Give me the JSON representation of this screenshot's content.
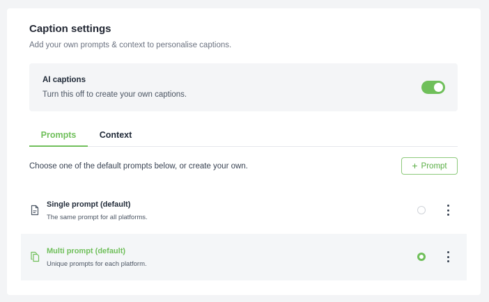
{
  "header": {
    "title": "Caption settings",
    "subtitle": "Add your own prompts & context to personalise captions."
  },
  "ai_captions": {
    "title": "AI captions",
    "description": "Turn this off to create your own captions.",
    "enabled": true
  },
  "tabs": [
    {
      "label": "Prompts",
      "active": true
    },
    {
      "label": "Context",
      "active": false
    }
  ],
  "prompts": {
    "instruction": "Choose one of the default prompts below, or create your own.",
    "add_button_label": "Prompt",
    "add_button_icon": "plus-icon",
    "items": [
      {
        "title": "Single prompt (default)",
        "description": "The same prompt for all platforms.",
        "icon": "document-icon",
        "selected": false
      },
      {
        "title": "Multi prompt (default)",
        "description": "Unique prompts for each platform.",
        "icon": "copy-documents-icon",
        "selected": true
      }
    ]
  },
  "colors": {
    "accent": "#6fbf5a",
    "panel": "#f4f5f7",
    "text": "#1f2937",
    "muted": "#6b7280"
  }
}
